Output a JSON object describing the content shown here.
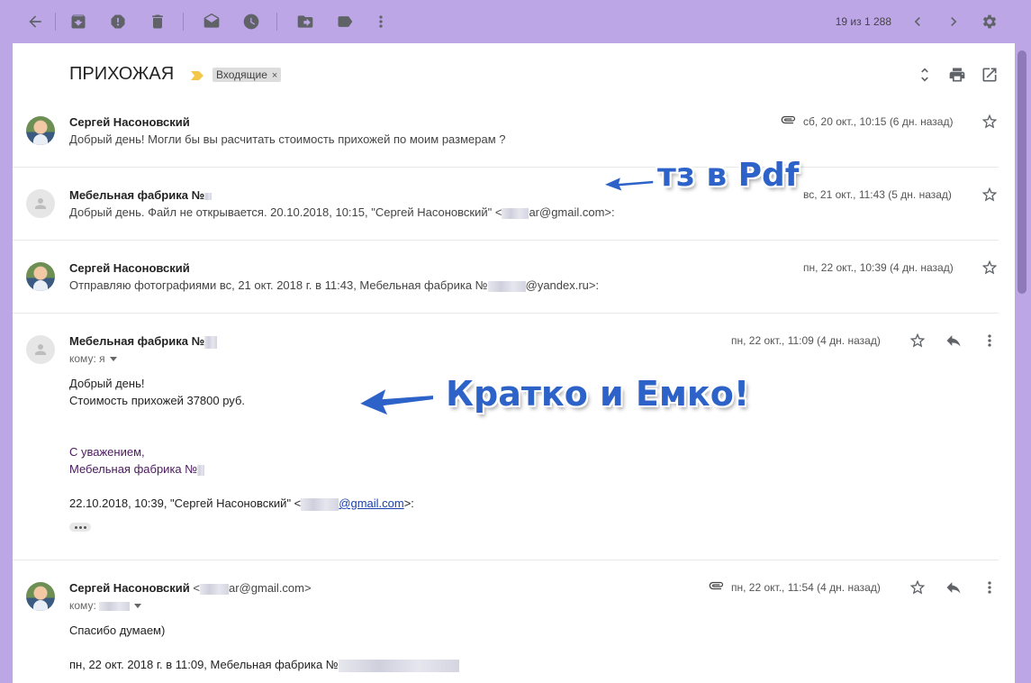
{
  "toolbar": {
    "pager_text": "19 из 1 288",
    "icons": [
      "back-arrow-icon",
      "archive-icon",
      "report-spam-icon",
      "delete-icon",
      "mark-unread-icon",
      "snooze-icon",
      "move-to-icon",
      "label-icon",
      "more-vert-icon",
      "chevron-left-icon",
      "chevron-right-icon",
      "gear-icon"
    ]
  },
  "thread": {
    "subject": "ПРИХОЖАЯ",
    "label": "Входящие",
    "label_remove": "×"
  },
  "messages": [
    {
      "sender": "Сергей Насоновский",
      "snippet": "Добрый день! Могли бы вы расчитать стоимость прихожей по моим размерам ?",
      "date": "сб, 20 окт., 10:15 (6 дн. назад)",
      "has_attachment": true
    },
    {
      "sender": "Мебельная фабрика №",
      "snippet_a": "Добрый день. Файл не открывается. 20.10.2018, 10:15, \"Сергей Насоновский\" <",
      "snippet_b": "ar@gmail.com>:",
      "date": "вс, 21 окт., 11:43 (5 дн. назад)"
    },
    {
      "sender": "Сергей Насоновский",
      "snippet_a": "Отправляю фотографиями вс, 21 окт. 2018 г. в 11:43, Мебельная фабрика №",
      "snippet_b": "@yandex.ru>:",
      "date": "пн, 22 окт., 10:39 (4 дн. назад)"
    },
    {
      "sender": "Мебельная фабрика №",
      "to": "кому: я",
      "date": "пн, 22 окт., 11:09 (4 дн. назад)",
      "body": [
        "Добрый день!",
        "Стоимость прихожей 37800 руб."
      ],
      "signature": [
        "С уважением,",
        "Мебельная фабрика №"
      ],
      "quote_prefix": "22.10.2018, 10:39, \"Сергей Насоновский\" <",
      "quote_link": "@gmail.com",
      "quote_suffix": ">:"
    },
    {
      "sender": "Сергей Насоновский",
      "sender_addr_a": "<",
      "sender_addr_b": "ar@gmail.com>",
      "to": "кому:",
      "date": "пн, 22 окт., 11:54 (4 дн. назад)",
      "has_attachment": true,
      "body": [
        "Спасибо думаем)"
      ],
      "quote_prefix": "пн, 22 окт. 2018 г. в 11:09, Мебельная фабрика №"
    }
  ],
  "annotations": {
    "tz_pdf": "тз  в Pdf",
    "short": "Кратко и Емко!",
    "color": "#2d63c8"
  }
}
